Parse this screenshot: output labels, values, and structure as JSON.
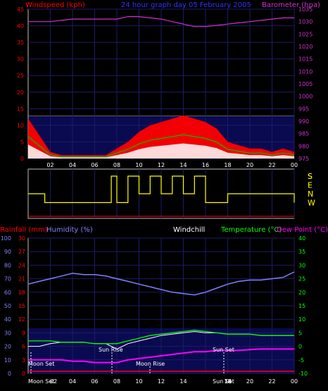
{
  "header": {
    "title": "24 hour graph day  05 February 2005"
  },
  "top_panel": {
    "left_label": "Windspeed (kph)",
    "right_label": "Barometer (hpa)",
    "left_ticks": [
      "45",
      "40",
      "35",
      "30",
      "25",
      "20",
      "15",
      "10",
      "5",
      "0"
    ],
    "right_ticks": [
      "1035",
      "1030",
      "1025",
      "1020",
      "1015",
      "1010",
      "1005",
      "1000",
      "995",
      "990",
      "985",
      "980",
      "975"
    ],
    "x_ticks": [
      "02",
      "04",
      "06",
      "08",
      "10",
      "12",
      "14",
      "16",
      "18",
      "20",
      "22",
      "00"
    ],
    "colors": {
      "windspeed": "#ff0000",
      "gust_outline": "#00c000",
      "wind_avg": "#ffffff",
      "barometer": "#cc33cc",
      "plot_bg": "#0a0a50"
    }
  },
  "direction_panel": {
    "letters": [
      "S",
      "E",
      "N",
      "W",
      "S"
    ],
    "color": "#ffff00"
  },
  "bottom_panel": {
    "label_rainfall": "Rainfall (mm)",
    "label_humidity": "Humidity (%)",
    "label_windchill": "Windchill",
    "label_temperature": "Temperature (°C)",
    "label_dewpoint": "Dew Point (°C)",
    "humidity_ticks": [
      "100",
      "90",
      "80",
      "70",
      "60",
      "50",
      "40",
      "30",
      "20",
      "10",
      "0"
    ],
    "rain_ticks": [
      "30",
      "27",
      "24",
      "21",
      "18",
      "15",
      "12",
      "9",
      "6",
      "3",
      "0"
    ],
    "temp_ticks": [
      "40",
      "35",
      "30",
      "25",
      "20",
      "15",
      "10",
      "5",
      "0",
      "-5",
      "-10"
    ],
    "x_ticks": [
      "02",
      "04",
      "06",
      "08",
      "10",
      "12",
      "14",
      "16",
      "18",
      "20",
      "22",
      "00"
    ],
    "annotations": {
      "moon_set_1": "Moon Set",
      "sun_rise": "Sun Rise",
      "moon_rise": "Moon Rise",
      "sun_set_1": "Sun Set",
      "moon_set_2": "Moon Set",
      "sun_set_2": "Sun Set",
      "axis_02": "02",
      "axis_16": "16"
    },
    "colors": {
      "humidity": "#8080ff",
      "temperature": "#00ff00",
      "dewpoint": "#ff00ff",
      "windchill": "#ffffff",
      "rainfall": "#ff0000",
      "plot_bg": "#0a0a50"
    }
  },
  "chart_data": [
    {
      "type": "line",
      "title": "24 hour graph day  05 February 2005",
      "ylabel": "Windspeed (kph)",
      "ylim": [
        0,
        45
      ],
      "y2label": "Barometer (hpa)",
      "y2lim": [
        975,
        1035
      ],
      "x": [
        0,
        1,
        2,
        3,
        4,
        5,
        6,
        7,
        8,
        9,
        10,
        11,
        12,
        13,
        14,
        15,
        16,
        17,
        18,
        19,
        20,
        21,
        22,
        23,
        24
      ],
      "series": [
        {
          "name": "Windspeed (kph)",
          "values": [
            12,
            7,
            2,
            1,
            1,
            1,
            1,
            1,
            3,
            5,
            8,
            10,
            11,
            12,
            13,
            12,
            11,
            9,
            5,
            4,
            3,
            3,
            2,
            3,
            2
          ]
        },
        {
          "name": "Barometer (hpa)",
          "values": [
            1030,
            1030,
            1030,
            1030.5,
            1031,
            1031,
            1031,
            1031,
            1031,
            1032,
            1032,
            1031.5,
            1031,
            1030,
            1029,
            1028,
            1028,
            1028.5,
            1029,
            1029.5,
            1030,
            1030.5,
            1031,
            1031.5,
            1031.5
          ]
        }
      ]
    },
    {
      "type": "line",
      "ylabel": "Wind direction",
      "categories": [
        "S",
        "E",
        "N",
        "W",
        "S"
      ],
      "x": [
        0,
        0.8,
        1.5,
        4,
        7.5,
        8,
        9,
        10,
        11,
        12,
        13,
        14,
        15,
        16,
        17,
        18,
        19,
        20,
        21,
        22,
        23,
        24
      ],
      "values": [
        "N",
        "N",
        "W",
        "W",
        "S",
        "W",
        "S",
        "N",
        "S",
        "N",
        "S",
        "N",
        "S",
        "W",
        "W",
        "N",
        "N",
        "N",
        "N",
        "N",
        "N",
        "W"
      ]
    },
    {
      "type": "line",
      "ylabel": "Humidity (%)",
      "ylim": [
        0,
        100
      ],
      "y2label": "Temperature (°C)",
      "y2lim": [
        -10,
        40
      ],
      "x": [
        0,
        1,
        2,
        3,
        4,
        5,
        6,
        7,
        8,
        9,
        10,
        11,
        12,
        13,
        14,
        15,
        16,
        17,
        18,
        19,
        20,
        21,
        22,
        23,
        24
      ],
      "series": [
        {
          "name": "Humidity (%)",
          "values": [
            66,
            68,
            70,
            72,
            74,
            73,
            73,
            72,
            70,
            68,
            66,
            64,
            62,
            60,
            59,
            58,
            60,
            63,
            66,
            68,
            69,
            69,
            70,
            71,
            75
          ]
        },
        {
          "name": "Temperature (°C)",
          "values": [
            2,
            2,
            2,
            1.5,
            1.5,
            1.5,
            1,
            1,
            1,
            2,
            3,
            4,
            4.5,
            5,
            5.5,
            6,
            5.5,
            5,
            4.5,
            4.5,
            4.5,
            4,
            4,
            4,
            4
          ]
        },
        {
          "name": "Dew Point (°C)",
          "values": [
            -5,
            -5,
            -5,
            -5,
            -5.5,
            -5.5,
            -6,
            -6,
            -6,
            -5,
            -4.5,
            -4,
            -3.5,
            -3,
            -2.5,
            -2,
            -2,
            -1.5,
            -1.5,
            -1.5,
            -1.2,
            -1,
            -1,
            -1,
            -1
          ]
        },
        {
          "name": "Windchill",
          "values": [
            0,
            0,
            1,
            1.5,
            1.5,
            1.5,
            1,
            1,
            -1,
            1,
            2,
            3,
            4,
            4.5,
            5,
            5.5,
            5,
            5,
            4.5,
            4.5,
            4.5,
            4,
            4,
            4,
            4
          ]
        },
        {
          "name": "Rainfall (mm)",
          "values": [
            0,
            0,
            0,
            0,
            0,
            0,
            0,
            0,
            0,
            0,
            0,
            0,
            0,
            0,
            0,
            0,
            0,
            0,
            0,
            0,
            0,
            0,
            0,
            0,
            0
          ]
        }
      ]
    }
  ]
}
